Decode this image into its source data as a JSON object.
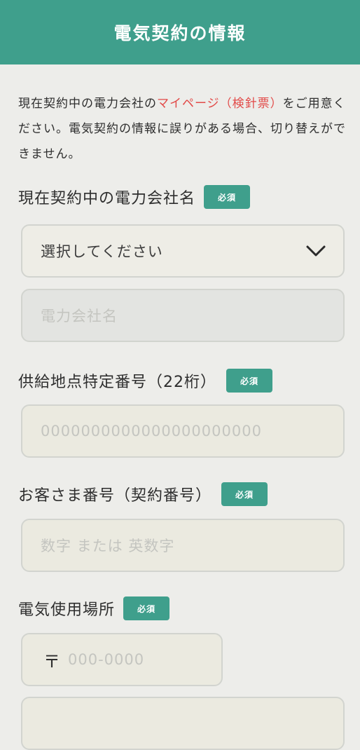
{
  "header": {
    "title": "電気契約の情報"
  },
  "intro": {
    "text_before": "現在契約中の電力会社の",
    "link": "マイページ（検針票）",
    "text_after": "をご用意ください。電気契約の情報に誤りがある場合、切り替えができません。"
  },
  "required_badge": "必須",
  "company": {
    "label": "現在契約中の電力会社名",
    "select_value": "選択してください",
    "select_icon": "chevron-down-icon",
    "name_placeholder": "電力会社名"
  },
  "supply_point": {
    "label": "供給地点特定番号（22桁）",
    "placeholder": "0000000000000000000000"
  },
  "customer_number": {
    "label": "お客さま番号（契約番号）",
    "placeholder": "数字 または 英数字"
  },
  "usage_location": {
    "label": "電気使用場所",
    "postal_mark": "〒",
    "postal_placeholder": "000-0000"
  },
  "colors": {
    "accent": "#3f9f8c",
    "link": "#e24a48",
    "placeholder": "#c4c5c0"
  }
}
